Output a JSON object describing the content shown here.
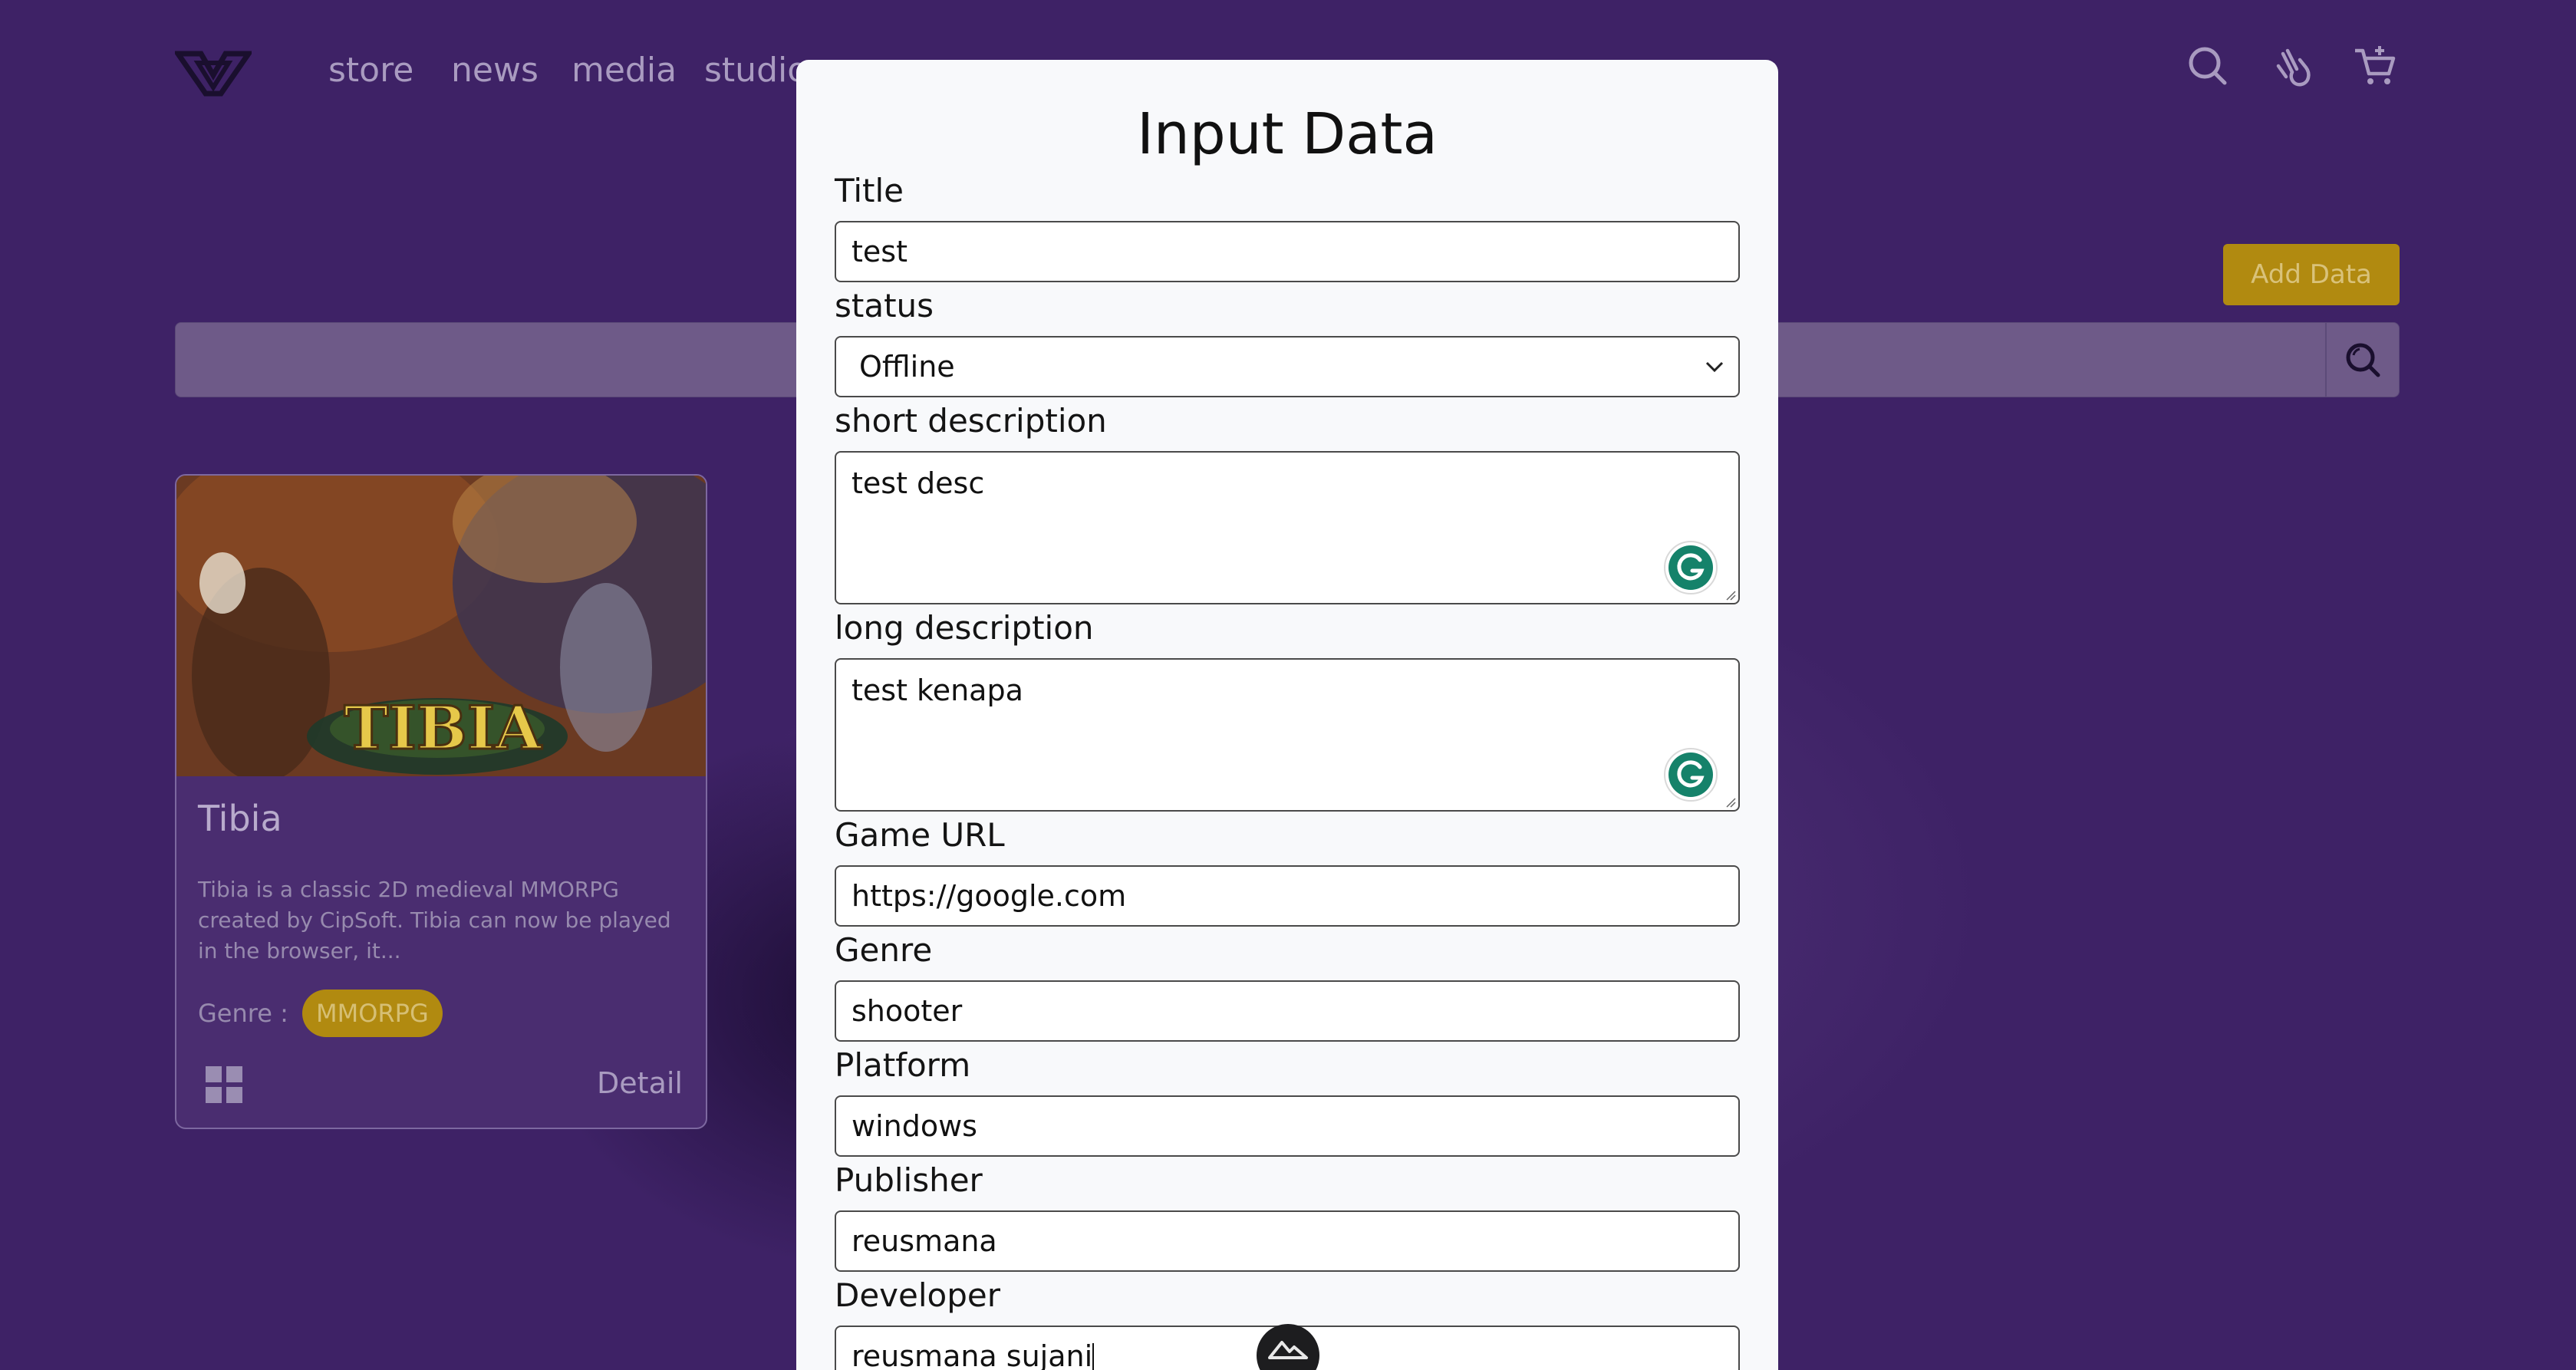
{
  "nav": {
    "links": [
      "store",
      "news",
      "media",
      "studio"
    ],
    "icons": [
      "search-icon",
      "hand-icon",
      "cart-icon"
    ]
  },
  "actions": {
    "add_data_label": "Add Data"
  },
  "search": {
    "placeholder": ""
  },
  "card": {
    "title": "Tibia",
    "image_text": "TIBIA",
    "description": "Tibia is a classic 2D medieval MMORPG created by CipSoft. Tibia can now be played in the browser, it...",
    "genre_label": "Genre :",
    "genre": "MMORPG",
    "detail_label": "Detail"
  },
  "modal": {
    "title": "Input Data",
    "fields": {
      "title": {
        "label": "Title",
        "value": "test"
      },
      "status": {
        "label": "status",
        "value": "Offline"
      },
      "short_description": {
        "label": "short description",
        "value": "test desc"
      },
      "long_description": {
        "label": "long description",
        "value": "test kenapa"
      },
      "game_url": {
        "label": "Game URL",
        "value": "https://google.com"
      },
      "genre": {
        "label": "Genre",
        "value": "shooter"
      },
      "platform": {
        "label": "Platform",
        "value": "windows"
      },
      "publisher": {
        "label": "Publisher",
        "value": "reusmana"
      },
      "developer": {
        "label": "Developer",
        "value": "reusmana sujani"
      }
    }
  },
  "colors": {
    "background": "#3e2266",
    "accent_gold": "#b18a10",
    "modal_bg": "#f8f9fb",
    "grammarly_green": "#15826a"
  }
}
